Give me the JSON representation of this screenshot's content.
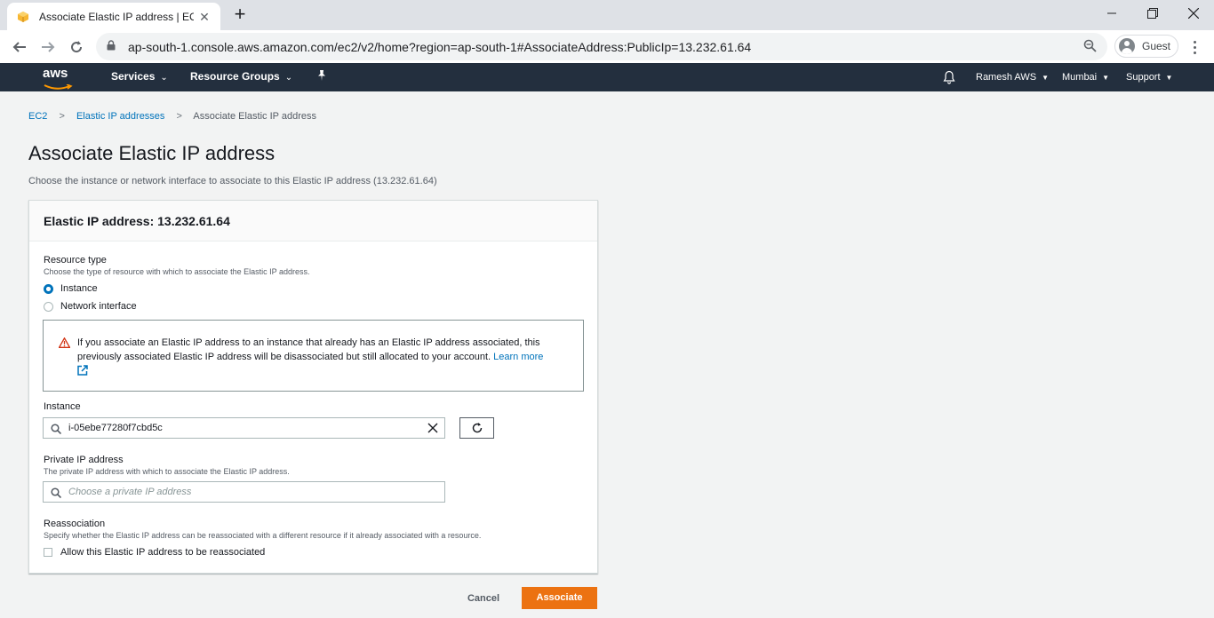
{
  "browser": {
    "tab_title": "Associate Elastic IP address | EC2",
    "tab_close": "✕",
    "new_tab": "+",
    "url": "ap-south-1.console.aws.amazon.com/ec2/v2/home?region=ap-south-1#AssociateAddress:PublicIp=13.232.61.64",
    "profile_label": "Guest"
  },
  "aws_nav": {
    "logo_text": "aws",
    "services": "Services",
    "resource_groups": "Resource Groups",
    "account": "Ramesh AWS",
    "region": "Mumbai",
    "support": "Support"
  },
  "breadcrumb": {
    "items": [
      "EC2",
      "Elastic IP addresses"
    ],
    "current": "Associate Elastic IP address"
  },
  "page": {
    "title": "Associate Elastic IP address",
    "description": "Choose the instance or network interface to associate to this Elastic IP address (13.232.61.64)"
  },
  "panel": {
    "header": "Elastic IP address: 13.232.61.64",
    "resource_type": {
      "label": "Resource type",
      "description": "Choose the type of resource with which to associate the Elastic IP address.",
      "options": [
        {
          "label": "Instance",
          "checked": true
        },
        {
          "label": "Network interface",
          "checked": false
        }
      ]
    },
    "warning": {
      "text": "If you associate an Elastic IP address to an instance that already has an Elastic IP address associated, this previously associated Elastic IP address will be disassociated but still allocated to your account. ",
      "link": "Learn more"
    },
    "instance": {
      "label": "Instance",
      "value": "i-05ebe77280f7cbd5c"
    },
    "private_ip": {
      "label": "Private IP address",
      "description": "The private IP address with which to associate the Elastic IP address.",
      "placeholder": "Choose a private IP address"
    },
    "reassociation": {
      "label": "Reassociation",
      "description": "Specify whether the Elastic IP address can be reassociated with a different resource if it already associated with a resource.",
      "checkbox_label": "Allow this Elastic IP address to be reassociated",
      "checked": false
    }
  },
  "actions": {
    "cancel": "Cancel",
    "associate": "Associate"
  },
  "colors": {
    "aws_nav_bg": "#232f3e",
    "primary_button": "#ec7211",
    "link": "#0073bb",
    "warning_icon": "#d13212"
  }
}
